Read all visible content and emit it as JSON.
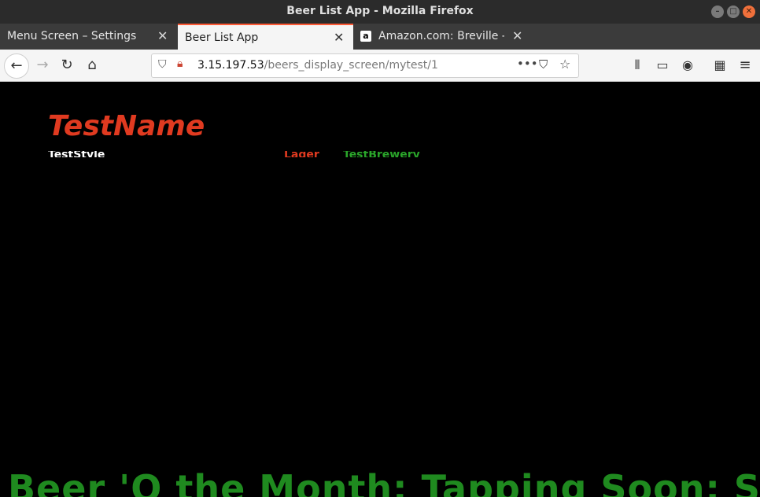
{
  "window": {
    "title": "Beer List App - Mozilla Firefox",
    "controls": [
      "minimize",
      "maximize",
      "close"
    ]
  },
  "tabs": [
    {
      "label": "Menu Screen – Settings",
      "active": false
    },
    {
      "label": "Beer List App",
      "active": true
    },
    {
      "label": "Amazon.com: Breville -th",
      "active": false,
      "favicon": "a"
    }
  ],
  "navbar": {
    "url_host": "3.15.197.53",
    "url_path": "/beers_display_screen/mytest/1"
  },
  "page": {
    "bar_name": "TestName",
    "partial_left": "TestStyle",
    "partial_mid1": "Lager",
    "partial_mid2": "TestBrewery",
    "ticker": "Beer 'O the Month:  Tapping Soon:  Sl"
  },
  "colors": {
    "accent_red": "#e03a20",
    "ticker_green": "#1f8a1f",
    "tab_accent": "#ff5a36"
  }
}
